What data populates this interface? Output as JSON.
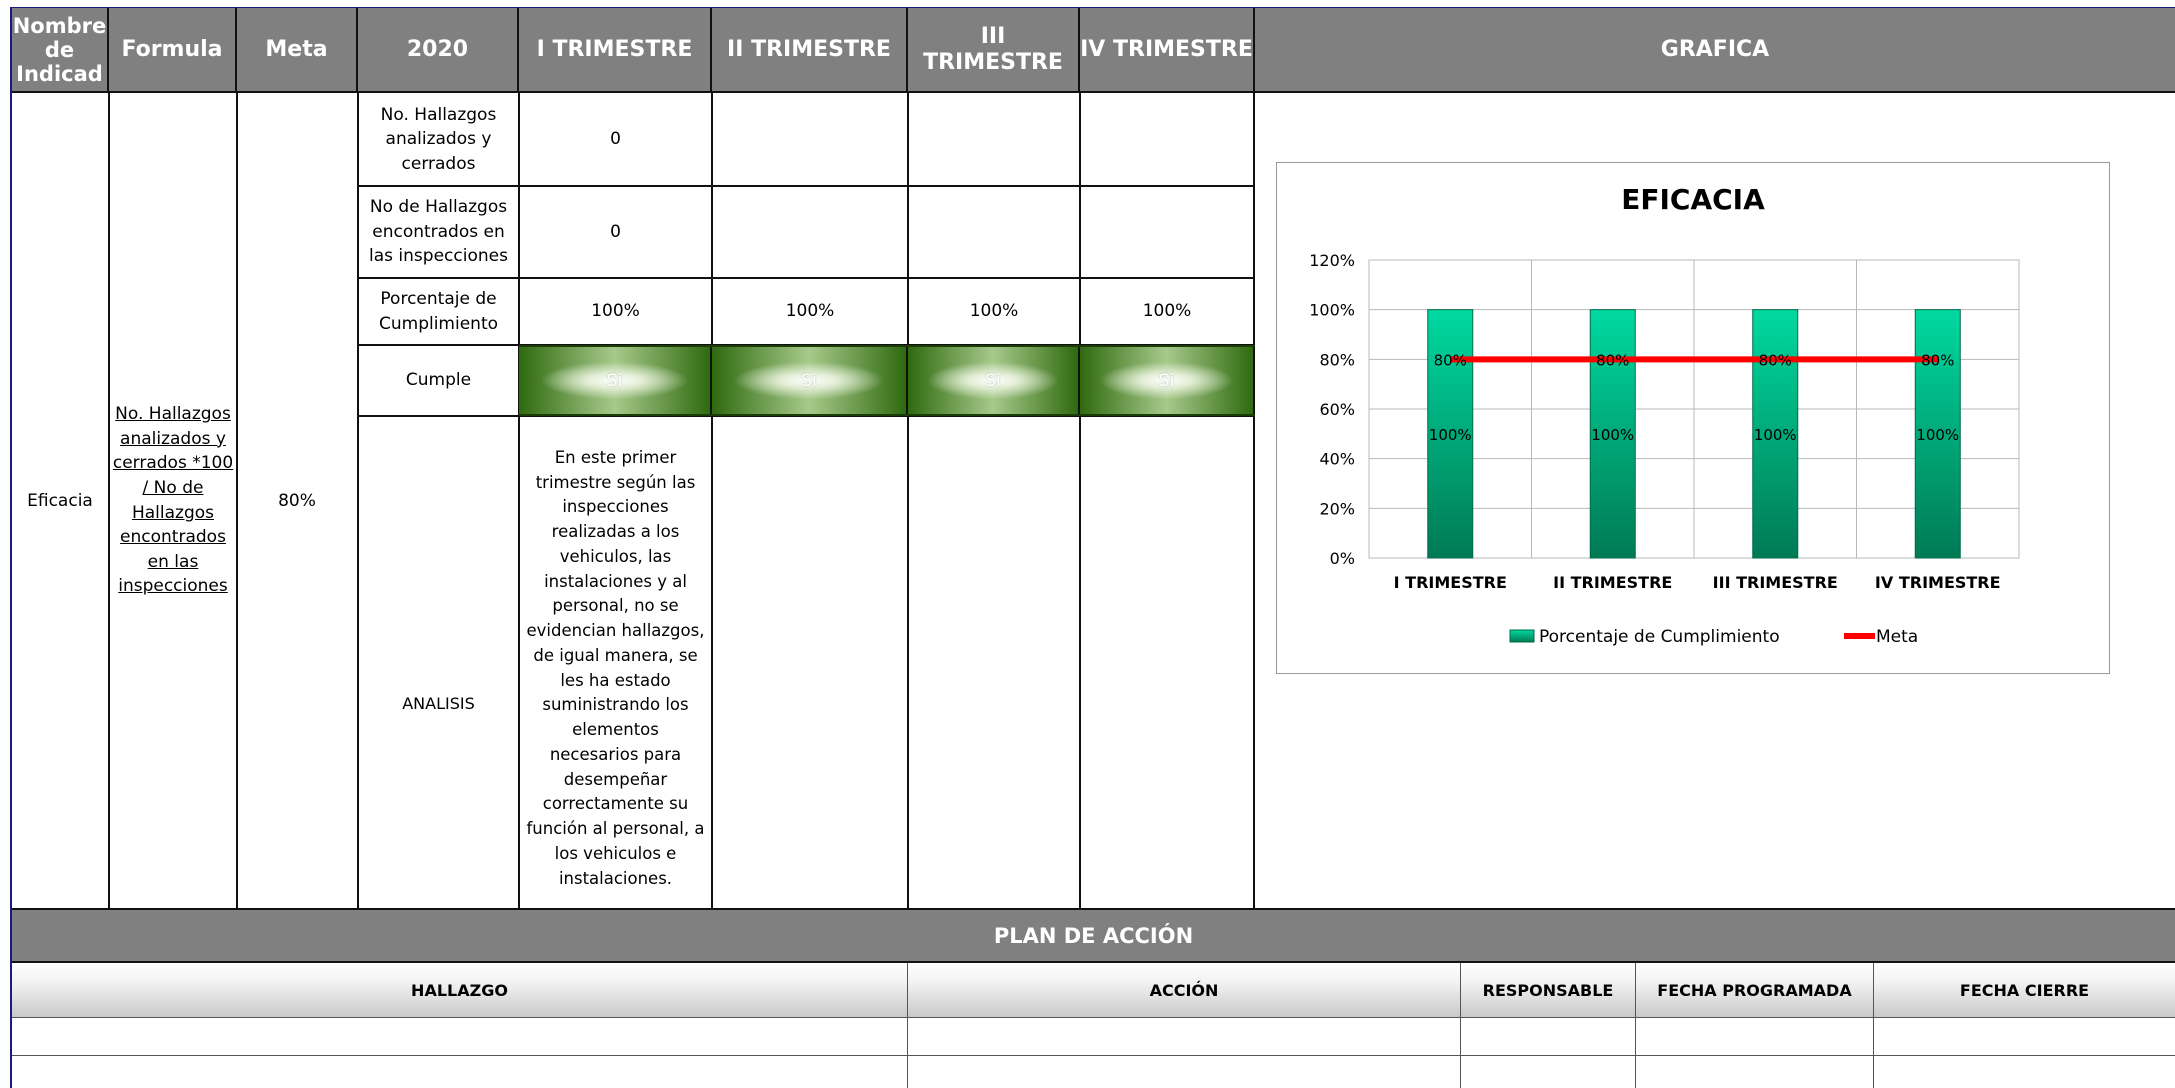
{
  "header": {
    "nombre": "Nombre de Indicad",
    "formula": "Formula",
    "meta": "Meta",
    "year": "2020",
    "q1": "I TRIMESTRE",
    "q2": "II TRIMESTRE",
    "q3": "III TRIMESTRE",
    "q4": "IV TRIMESTRE",
    "grafica": "GRAFICA"
  },
  "indicator": {
    "name": "Eficacia",
    "formula": "No. Hallazgos analizados y cerrados *100 / No de Hallazgos encontrados en las inspecciones",
    "meta": "80%"
  },
  "rows": {
    "r1_label": "No. Hallazgos analizados y cerrados",
    "r1_q1": "0",
    "r2_label": "No de Hallazgos encontrados en las inspecciones",
    "r2_q1": "0",
    "r3_label": "Porcentaje de Cumplimiento",
    "r3_q1": "100%",
    "r3_q2": "100%",
    "r3_q3": "100%",
    "r3_q4": "100%",
    "r4_label": "Cumple",
    "r4_q1": "Si",
    "r4_q2": "Si",
    "r4_q3": "Si",
    "r4_q4": "Si",
    "r5_label": "ANALISIS",
    "r5_q1": "En este primer trimestre según las inspecciones realizadas a los vehiculos, las instalaciones y al personal, no se evidencian hallazgos, de igual manera, se les ha estado suministrando los elementos necesarios para desempeñar correctamente su función al personal, a los vehiculos e instalaciones."
  },
  "chart_data": {
    "type": "bar",
    "title": "EFICACIA",
    "categories": [
      "I TRIMESTRE",
      "II TRIMESTRE",
      "III TRIMESTRE",
      "IV TRIMESTRE"
    ],
    "series": [
      {
        "name": "Porcentaje de Cumplimiento",
        "type": "bar",
        "values": [
          100,
          100,
          100,
          100
        ],
        "labels": [
          "100%",
          "100%",
          "100%",
          "100%"
        ],
        "color": "#00a878"
      },
      {
        "name": "Meta",
        "type": "line",
        "values": [
          80,
          80,
          80,
          80
        ],
        "labels": [
          "80%",
          "80%",
          "80%",
          "80%"
        ],
        "color": "#ff0000"
      }
    ],
    "yticks": [
      "0%",
      "20%",
      "40%",
      "60%",
      "80%",
      "100%",
      "120%"
    ],
    "ylim": [
      0,
      120
    ],
    "grid": true,
    "legend": "bottom"
  },
  "plan": {
    "title": "PLAN DE ACCIÓN",
    "columns": [
      "HALLAZGO",
      "ACCIÓN",
      "RESPONSABLE",
      "FECHA PROGRAMADA",
      "FECHA CIERRE"
    ]
  },
  "colors": {
    "header_bg": "#808080",
    "cumple_green": "#2f6a0f",
    "bar": "#00a878",
    "meta_line": "#ff0000"
  }
}
